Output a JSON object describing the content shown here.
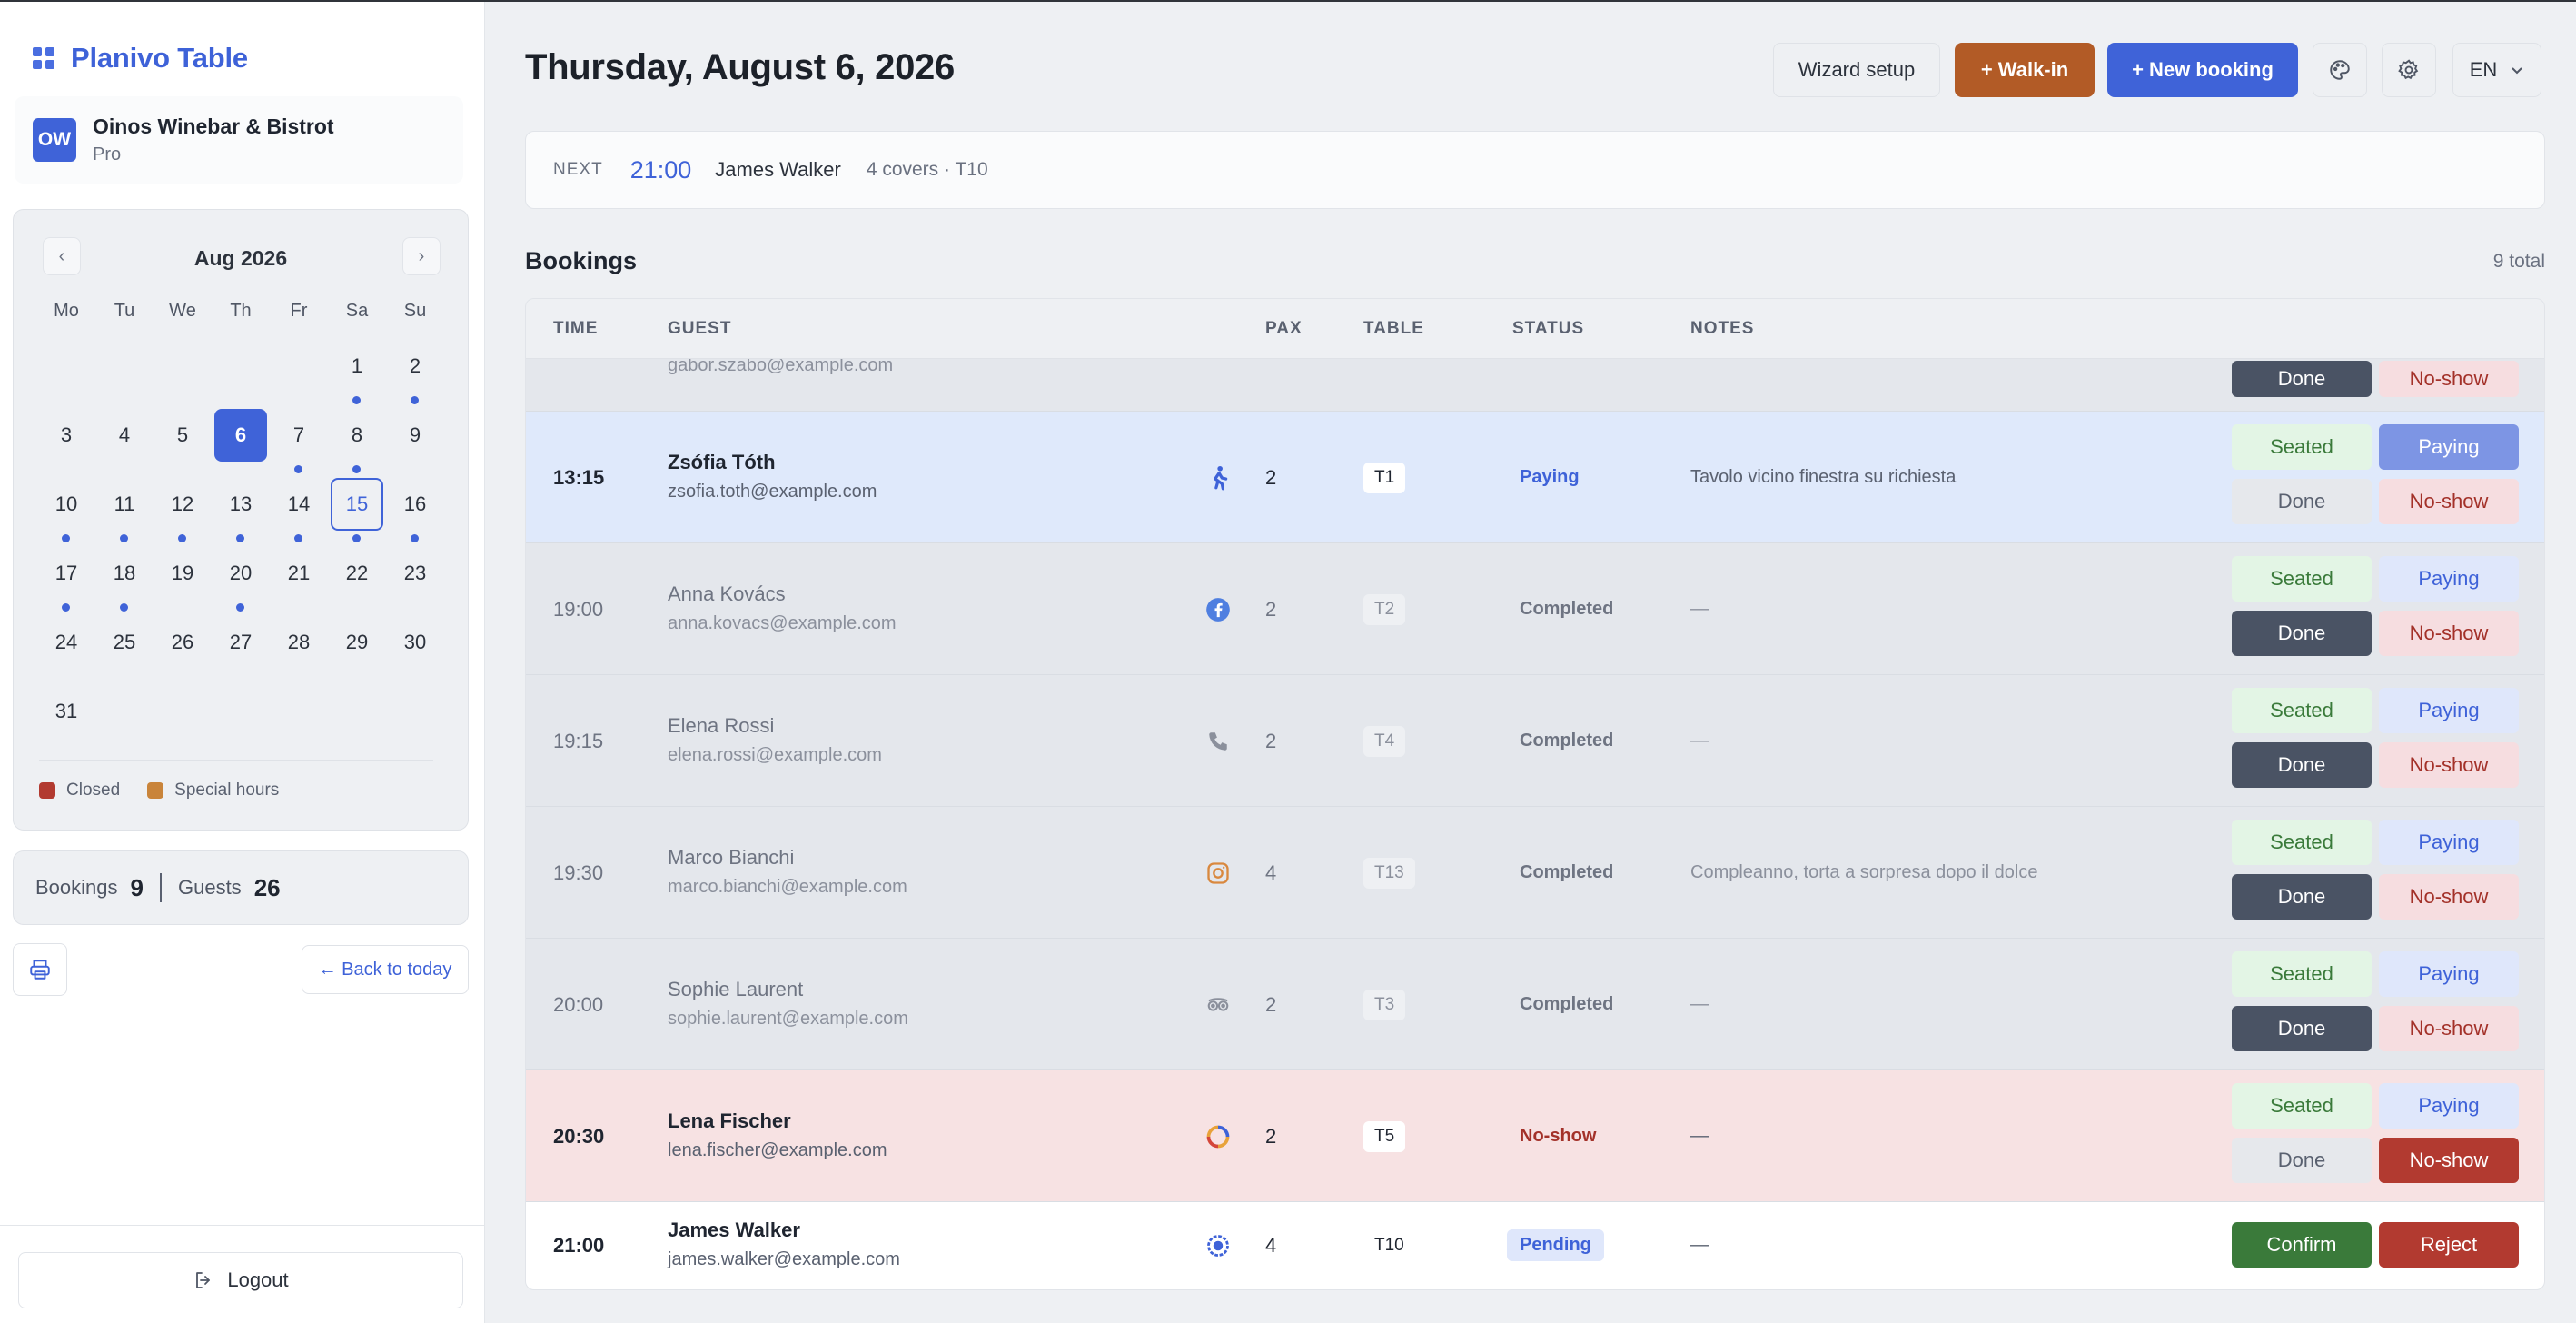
{
  "app": {
    "brand": "Planivo Table"
  },
  "org": {
    "initials": "OW",
    "name": "Oinos Winebar & Bistrot",
    "plan": "Pro"
  },
  "calendar": {
    "month_label": "Aug 2026",
    "prev": "‹",
    "next": "›",
    "weekdays": [
      "Mo",
      "Tu",
      "We",
      "Th",
      "Fr",
      "Sa",
      "Su"
    ],
    "weeks": [
      [
        "",
        "",
        "",
        "",
        "",
        "1",
        "2"
      ],
      [
        "3",
        "4",
        "5",
        "6",
        "7",
        "8",
        "9"
      ],
      [
        "10",
        "11",
        "12",
        "13",
        "14",
        "15",
        "16"
      ],
      [
        "17",
        "18",
        "19",
        "20",
        "21",
        "22",
        "23"
      ],
      [
        "24",
        "25",
        "26",
        "27",
        "28",
        "29",
        "30"
      ],
      [
        "31",
        "",
        "",
        "",
        "",
        "",
        ""
      ]
    ],
    "selected_day": "6",
    "today_day": "15",
    "days_with_bookings": [
      "1",
      "2",
      "7",
      "8",
      "10",
      "11",
      "12",
      "13",
      "14",
      "15",
      "16",
      "17",
      "18",
      "20"
    ],
    "legend": [
      {
        "label": "Closed",
        "color": "#b23a30"
      },
      {
        "label": "Special hours",
        "color": "#c9843a"
      }
    ]
  },
  "stats": {
    "bookings_label": "Bookings",
    "bookings": "9",
    "guests_label": "Guests",
    "guests": "26"
  },
  "sidebar_actions": {
    "back_to_today": "← Back to today",
    "logout": "Logout"
  },
  "header": {
    "date_title": "Thursday, August 6, 2026",
    "wizard": "Wizard setup",
    "walkin": "+ Walk-in",
    "new_booking": "+ New booking",
    "language": "EN"
  },
  "next_up": {
    "label": "NEXT",
    "time": "21:00",
    "guest": "James Walker",
    "meta": "4 covers · T10"
  },
  "bookings": {
    "title": "Bookings",
    "total": "9 total",
    "columns": {
      "time": "TIME",
      "guest": "GUEST",
      "pax": "PAX",
      "table": "TABLE",
      "status": "STATUS",
      "notes": "NOTES"
    },
    "partial_row": {
      "email": "gabor.szabo@example.com",
      "done": "Done",
      "noshow": "No-show"
    },
    "rows": [
      {
        "time": "13:15",
        "name": "Zsófia Tóth",
        "email": "zsofia.toth@example.com",
        "source": "walk-in-icon",
        "pax": "2",
        "table": "T1",
        "status": "Paying",
        "notes": "Tavolo vicino finestra su richiesta",
        "state": "paying"
      },
      {
        "time": "19:00",
        "name": "Anna Kovács",
        "email": "anna.kovacs@example.com",
        "source": "facebook-icon",
        "pax": "2",
        "table": "T2",
        "status": "Completed",
        "notes": "—",
        "state": "completed"
      },
      {
        "time": "19:15",
        "name": "Elena Rossi",
        "email": "elena.rossi@example.com",
        "source": "phone-icon",
        "pax": "2",
        "table": "T4",
        "status": "Completed",
        "notes": "—",
        "state": "completed"
      },
      {
        "time": "19:30",
        "name": "Marco Bianchi",
        "email": "marco.bianchi@example.com",
        "source": "instagram-icon",
        "pax": "4",
        "table": "T13",
        "status": "Completed",
        "notes": "Compleanno, torta a sorpresa dopo il dolce",
        "state": "completed"
      },
      {
        "time": "20:00",
        "name": "Sophie Laurent",
        "email": "sophie.laurent@example.com",
        "source": "tripadvisor-icon",
        "pax": "2",
        "table": "T3",
        "status": "Completed",
        "notes": "—",
        "state": "completed"
      },
      {
        "time": "20:30",
        "name": "Lena Fischer",
        "email": "lena.fischer@example.com",
        "source": "google-icon",
        "pax": "2",
        "table": "T5",
        "status": "No-show",
        "notes": "—",
        "state": "noshow"
      },
      {
        "time": "21:00",
        "name": "James Walker",
        "email": "james.walker@example.com",
        "source": "web-icon",
        "pax": "4",
        "table": "T10",
        "status": "Pending",
        "notes": "—",
        "state": "pending"
      }
    ],
    "actions": {
      "seated": "Seated",
      "paying": "Paying",
      "done": "Done",
      "noshow": "No-show",
      "confirm": "Confirm",
      "reject": "Reject"
    }
  },
  "colors": {
    "accent": "#3f63d8",
    "walkin": "#b25b26",
    "done": "#4a5364",
    "noshow": "#b23a30",
    "confirm": "#3a7a3a"
  }
}
